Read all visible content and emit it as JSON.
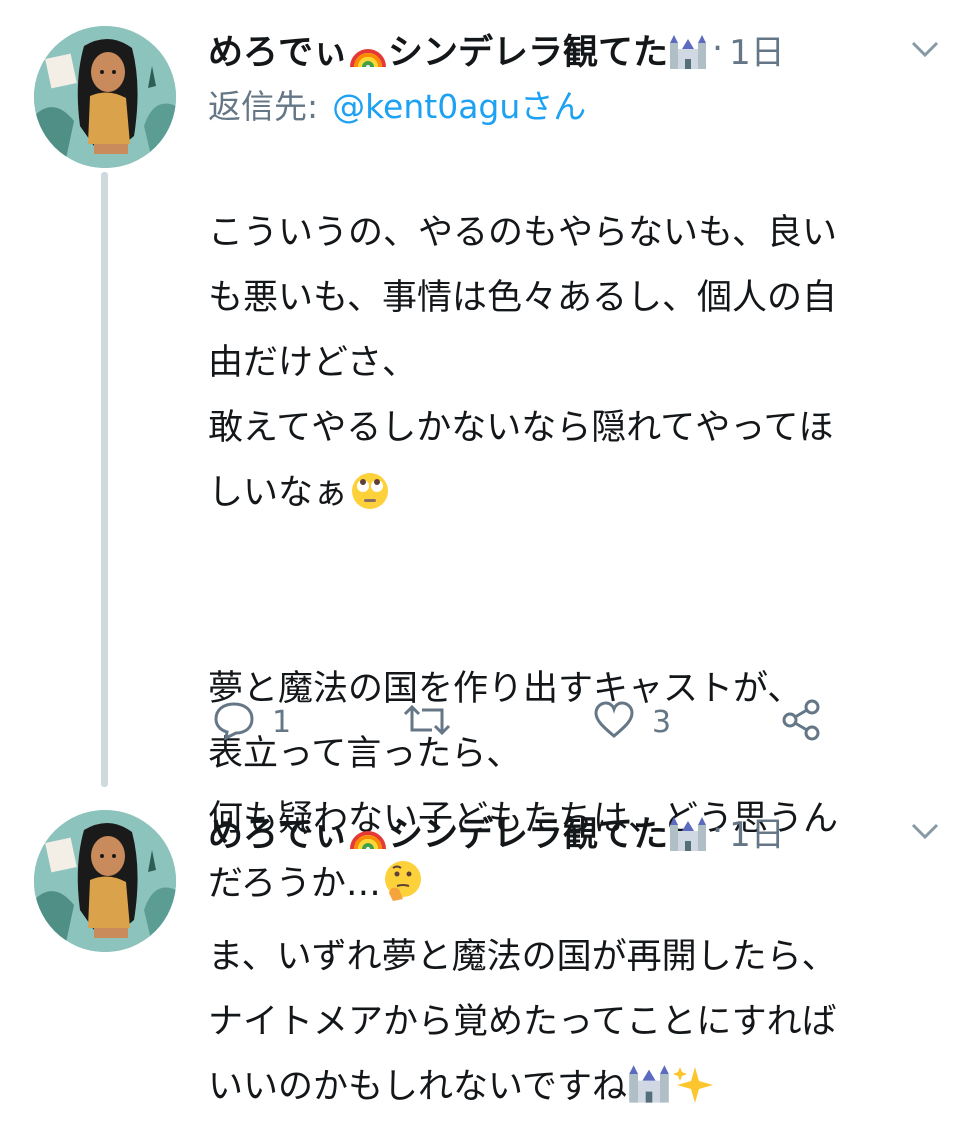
{
  "tweets": [
    {
      "user": {
        "display_name": "めろでぃ",
        "suffix": "シンデレラ観てた"
      },
      "time": "1日",
      "reply_label": "返信先:",
      "reply_handle": "@kent0aguさん",
      "text": "こういうの、やるのもやらないも、良い\nも悪いも、事情は色々あるし、個人の自\n由だけどさ、\n敢えてやるしかないなら隠れてやってほ\nしいなぁ",
      "text2": "夢と魔法の国を作り出すキャストが、\n表立って言ったら、\n何も疑わない子どもたちは、どう思うん\nだろうか…",
      "icons": {
        "rainbow": "rainbow-emoji",
        "castle": "castle-emoji",
        "rolling_eyes": "rolling-eyes-emoji",
        "thinking": "thinking-face-emoji"
      },
      "actions": {
        "reply_count": "1",
        "retweet_count": "",
        "like_count": "3"
      }
    },
    {
      "user": {
        "display_name": "めろでぃ",
        "suffix": "シンデレラ観てた"
      },
      "time": "1日",
      "text": "ま、いずれ夢と魔法の国が再開したら、\nナイトメアから覚めたってことにすれば\nいいのかもしれないですね",
      "icons": {
        "castle": "castle-emoji",
        "sparkles": "sparkles-emoji"
      }
    }
  ],
  "colors": {
    "link": "#1da1f2",
    "muted": "#657786",
    "text": "#14171a",
    "thread_line": "#cfd9de"
  }
}
